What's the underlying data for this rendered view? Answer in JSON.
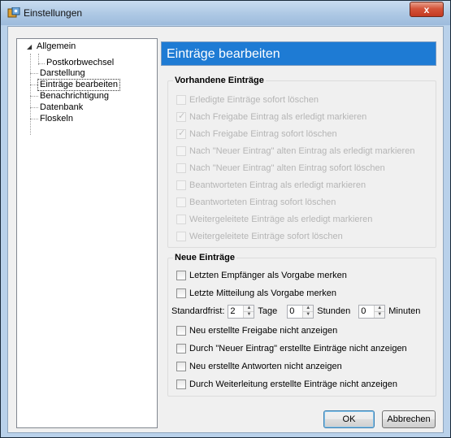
{
  "window": {
    "title": "Einstellungen",
    "close_glyph": "x"
  },
  "tree": {
    "items": [
      {
        "label": "Allgemein",
        "expander": "◢"
      },
      {
        "label": "Postkorbwechsel"
      },
      {
        "label": "Darstellung"
      },
      {
        "label": "Einträge bearbeiten"
      },
      {
        "label": "Benachrichtigung"
      },
      {
        "label": "Datenbank"
      },
      {
        "label": "Floskeln"
      }
    ]
  },
  "header": {
    "title": "Einträge bearbeiten"
  },
  "existing": {
    "title": "Vorhandene Einträge",
    "items": [
      {
        "label": "Erledigte Einträge sofort löschen",
        "checked": false
      },
      {
        "label": "Nach Freigabe Eintrag als erledigt markieren",
        "checked": true
      },
      {
        "label": "Nach Freigabe Eintrag sofort löschen",
        "checked": true
      },
      {
        "label": "Nach \"Neuer Eintrag\" alten Eintrag als erledigt markieren",
        "checked": false
      },
      {
        "label": "Nach \"Neuer Eintrag\" alten Eintrag sofort löschen",
        "checked": false
      },
      {
        "label": "Beantworteten Eintrag als erledigt markieren",
        "checked": false
      },
      {
        "label": "Beantworteten Eintrag sofort löschen",
        "checked": false
      },
      {
        "label": "Weitergeleitete Einträge als erledigt markieren",
        "checked": false
      },
      {
        "label": "Weitergeleitete Einträge sofort löschen",
        "checked": false
      }
    ]
  },
  "new_entries": {
    "title": "Neue Einträge",
    "remember_recipient": "Letzten Empfänger als Vorgabe merken",
    "remember_message": "Letzte Mitteilung als Vorgabe merken",
    "deadline": {
      "label": "Standardfrist:",
      "days_value": "2",
      "days_unit": "Tage",
      "hours_value": "0",
      "hours_unit": "Stunden",
      "minutes_value": "0",
      "minutes_unit": "Minuten"
    },
    "hide_release": "Neu erstellte Freigabe nicht anzeigen",
    "hide_new": "Durch \"Neuer Eintrag\" erstellte Einträge nicht anzeigen",
    "hide_answers": "Neu erstellte Antworten nicht anzeigen",
    "hide_forwarded": "Durch Weiterleitung erstellte Einträge nicht anzeigen"
  },
  "buttons": {
    "ok": "OK",
    "cancel": "Abbrechen"
  }
}
